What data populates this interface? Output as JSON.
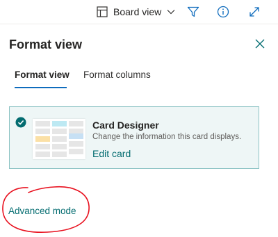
{
  "toolbar": {
    "view_label": "Board view",
    "view_icon": "board-icon",
    "buttons": [
      {
        "icon": "filter-icon"
      },
      {
        "icon": "info-icon"
      },
      {
        "icon": "expand-icon"
      }
    ]
  },
  "panel": {
    "title": "Format view",
    "close_icon": "close-icon"
  },
  "tabs": [
    {
      "label": "Format view",
      "active": true
    },
    {
      "label": "Format columns",
      "active": false
    }
  ],
  "card_option": {
    "title": "Card Designer",
    "description": "Change the information this card displays.",
    "link": "Edit card",
    "selected": true
  },
  "advanced_link": "Advanced mode",
  "colors": {
    "accent": "#036c70",
    "tab_underline": "#0f6cbd",
    "card_border": "#8cc3c4",
    "card_background": "#eef6f6",
    "annotation": "#e8101e"
  }
}
